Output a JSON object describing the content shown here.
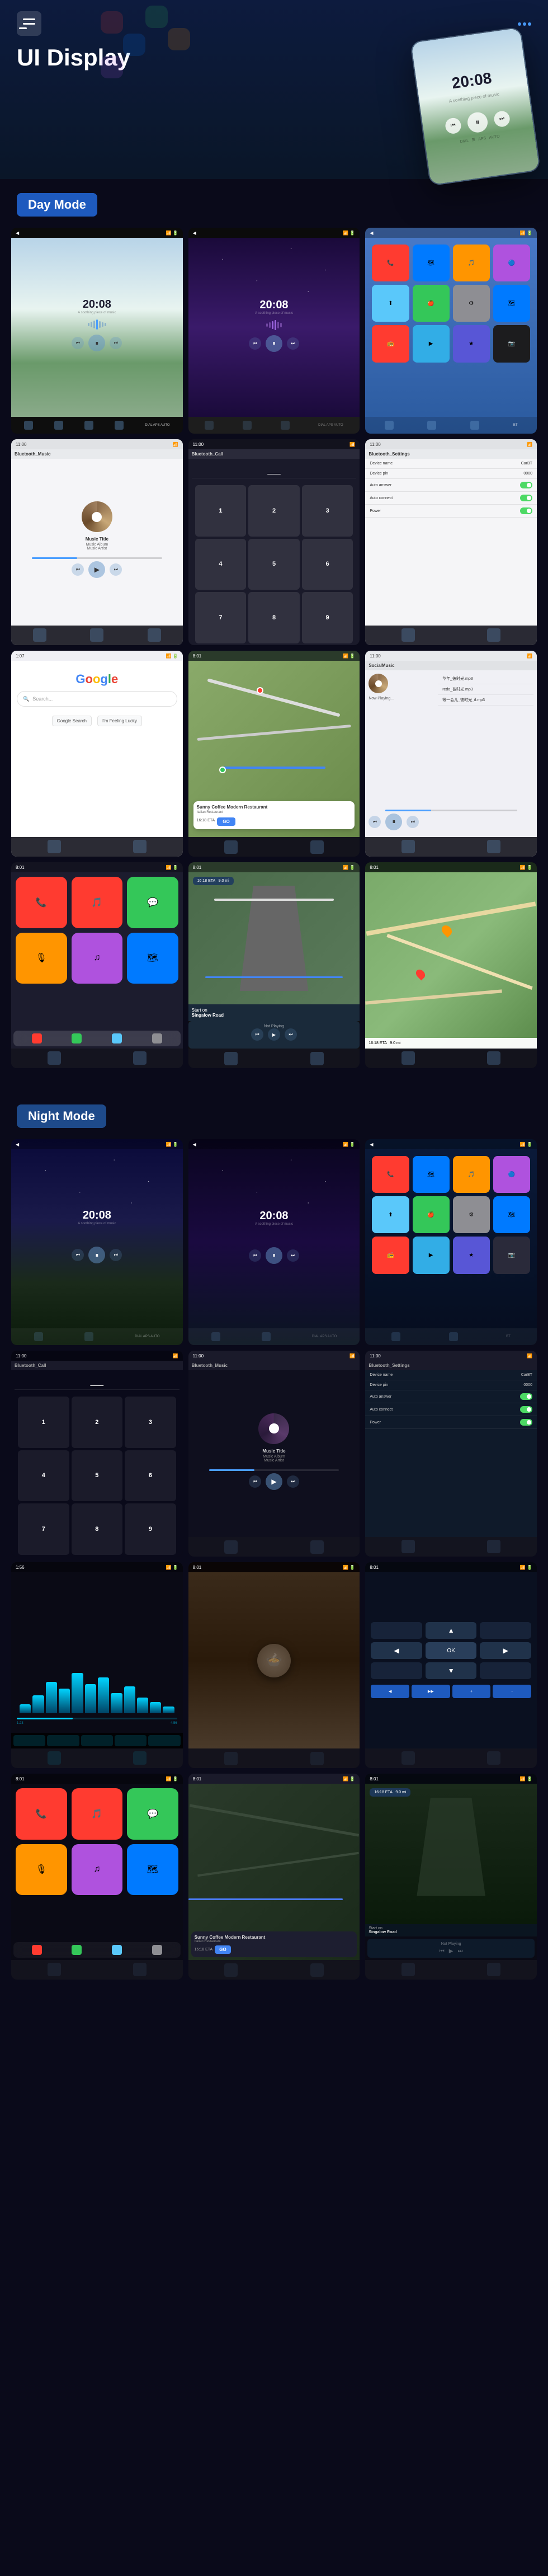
{
  "header": {
    "title": "UI Display",
    "hamburger_label": "menu",
    "dots_label": "more"
  },
  "sections": {
    "day_mode": {
      "label": "Day Mode"
    },
    "night_mode": {
      "label": "Night Mode"
    }
  },
  "screens": {
    "time": "20:08",
    "music_title": "Music Title",
    "music_album": "Music Album",
    "music_artist": "Music Artist",
    "device_name": "CarBT",
    "device_pin": "0000",
    "auto_answer": "Auto answer",
    "auto_connect": "Auto connect",
    "power": "Power",
    "bluetooth_music": "Bluetooth_Music",
    "bluetooth_call": "Bluetooth_Call",
    "bluetooth_settings": "Bluetooth_Settings",
    "social_music": "SocialMusic",
    "google_text": "Google",
    "restaurant_name": "Sunny Coffee Modern Restaurant",
    "restaurant_detail": "Italian Restaurant Details here",
    "go_btn": "GO",
    "eta": "16:18 ETA",
    "distance": "9.0 mi",
    "not_playing": "Not Playing",
    "start_on": "Start on",
    "singalow_road": "Singalow Road"
  },
  "day_screens": [
    {
      "type": "music_landscape",
      "time": "20:08"
    },
    {
      "type": "music_space",
      "time": "20:08"
    },
    {
      "type": "app_grid"
    },
    {
      "type": "bluetooth_music"
    },
    {
      "type": "bluetooth_call"
    },
    {
      "type": "bluetooth_settings"
    },
    {
      "type": "google"
    },
    {
      "type": "waze_map"
    },
    {
      "type": "social_music"
    }
  ],
  "navigation": {
    "carplay_icon": "🍎",
    "waze_icon": "🗺",
    "maps_icon": "🗺"
  }
}
